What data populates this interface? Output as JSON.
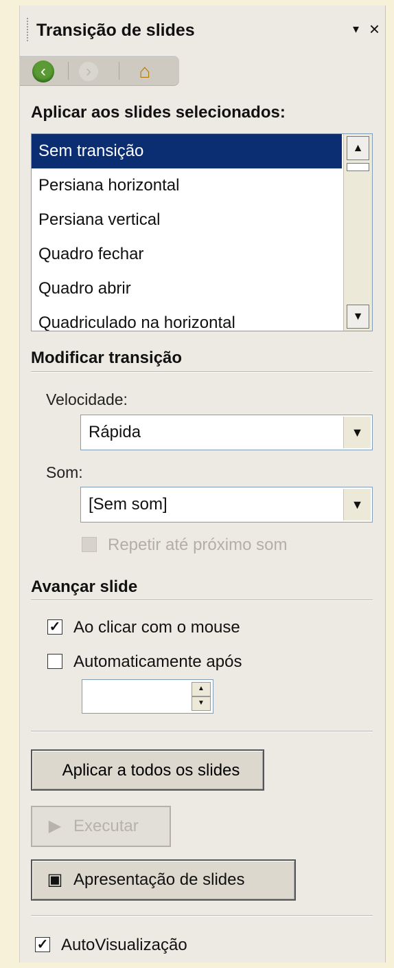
{
  "panel": {
    "title": "Transição de slides",
    "menu_icon": "▾",
    "close_icon": "×"
  },
  "nav": {
    "back_icon": "‹",
    "forward_icon": "›",
    "home_icon": "⌂"
  },
  "transitions": {
    "heading": "Aplicar aos slides selecionados:",
    "items": [
      "Sem transição",
      "Persiana horizontal",
      "Persiana vertical",
      "Quadro fechar",
      "Quadro abrir",
      "Quadriculado na horizontal"
    ],
    "selected_index": 0,
    "scroll_up_icon": "▲",
    "scroll_down_icon": "▼"
  },
  "modify": {
    "heading": "Modificar transição",
    "speed_label": "Velocidade:",
    "speed_value": "Rápida",
    "sound_label": "Som:",
    "sound_value": "[Sem som]",
    "repeat_label": "Repetir até próximo som",
    "dropdown_icon": "▼"
  },
  "advance": {
    "heading": "Avançar slide",
    "on_click_label": "Ao clicar com o mouse",
    "on_click_checked": true,
    "auto_label": "Automaticamente após",
    "auto_checked": false,
    "auto_value": "",
    "spin_up_icon": "▲",
    "spin_down_icon": "▼"
  },
  "actions": {
    "apply_all": "Aplicar a todos os slides",
    "run": "Executar",
    "run_icon": "▶",
    "slideshow": "Apresentação de slides",
    "slideshow_icon": "▣"
  },
  "preview": {
    "label": "AutoVisualização",
    "checked": true
  },
  "check_icon": "✓"
}
